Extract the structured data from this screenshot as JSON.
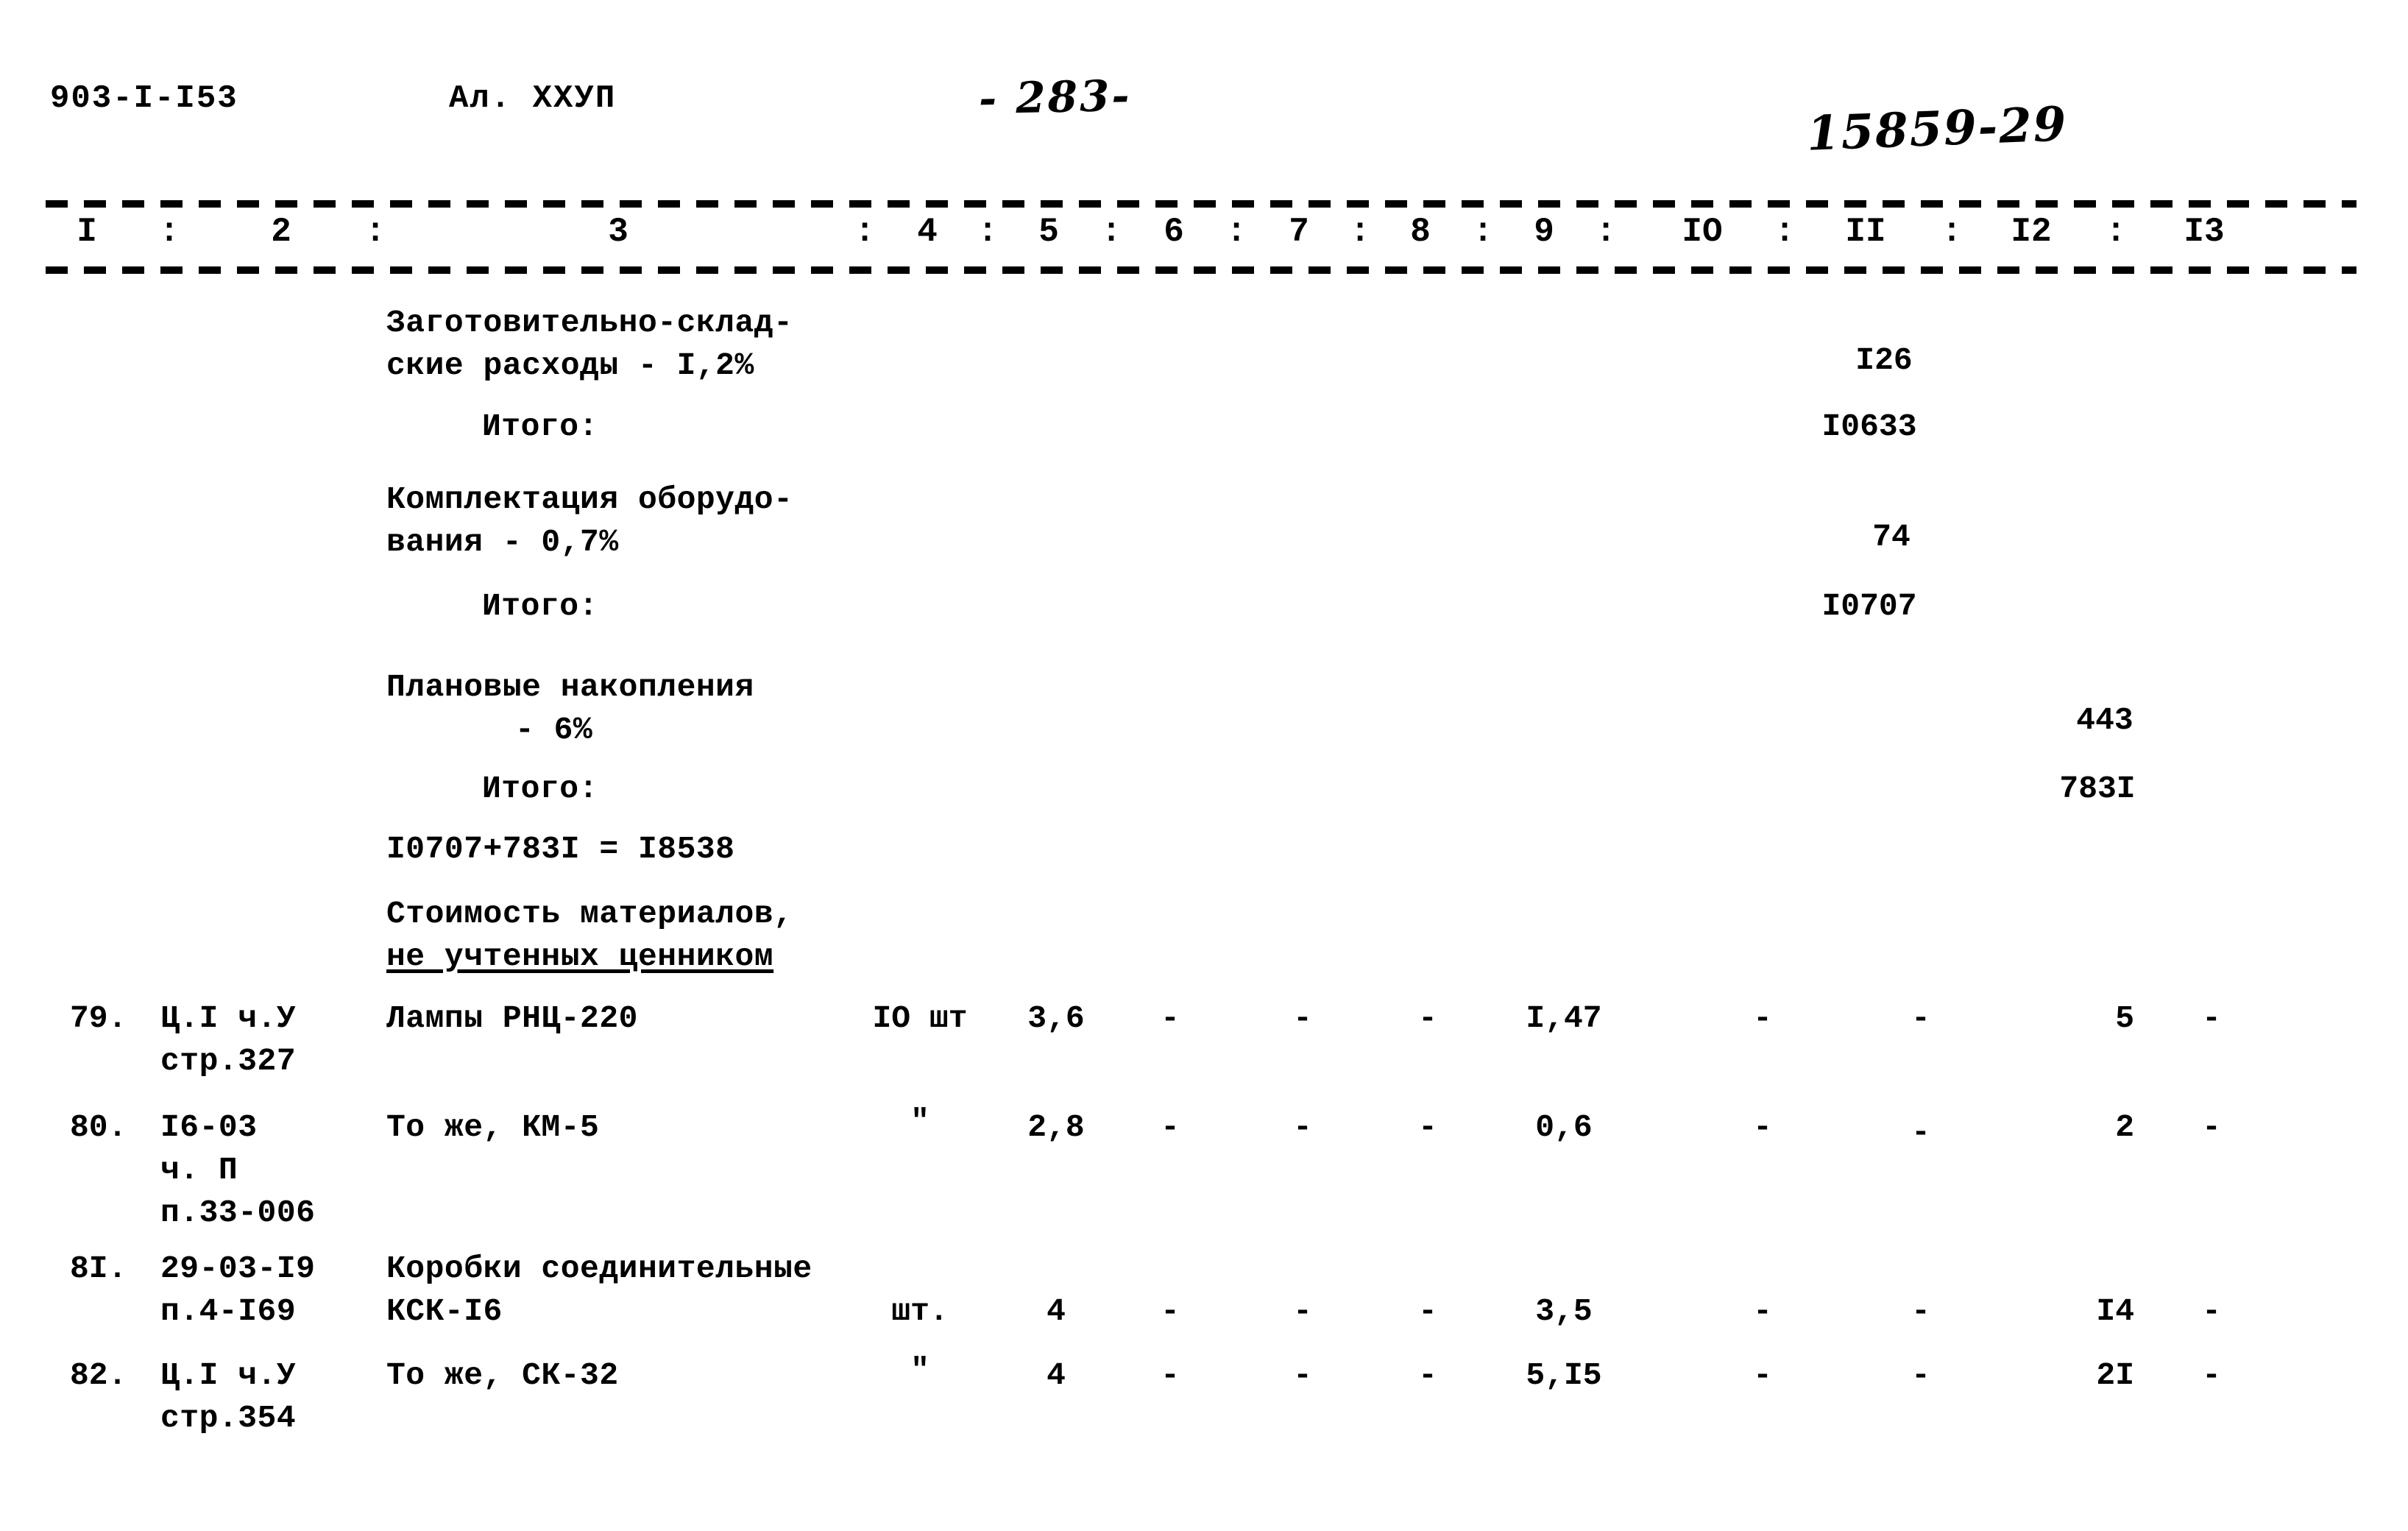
{
  "header": {
    "doc_code": "903-I-I53",
    "album": "Ал. ХХУП",
    "page_number": "- 283-",
    "archive_code": "15859-29"
  },
  "table": {
    "column_numbers": [
      "I",
      "2",
      "3",
      "4",
      "5",
      "6",
      "7",
      "8",
      "9",
      "IO",
      "II",
      "I2",
      "I3"
    ],
    "separator": ":"
  },
  "summary_rows": [
    {
      "name_line1": "Заготовительно-склад-",
      "name_line2": "ские расходы - I,2%",
      "col11": "I26"
    },
    {
      "name_line1": "Итого:",
      "col11": "I0633"
    },
    {
      "name_line1": "Комплектация оборудо-",
      "name_line2": "вания - 0,7%",
      "col11": "74"
    },
    {
      "name_line1": "Итого:",
      "col11": "I0707"
    },
    {
      "name_line1": "Плановые накопления",
      "name_line2": "- 6%",
      "col12": "443"
    },
    {
      "name_line1": "Итого:",
      "col12": "783I"
    },
    {
      "name_line1": "I0707+783I = I8538"
    }
  ],
  "section_heading": {
    "line1": "Стоимость материалов,",
    "line2": "не учтенных ценником"
  },
  "item_rows": [
    {
      "number": "79.",
      "code_line1": "Ц.I ч.У",
      "code_line2": "стр.327",
      "name": "Лампы РНЦ-220",
      "unit": "IO шт",
      "col4": "3,6",
      "col5": "-",
      "col6": "-",
      "col7": "-",
      "col8": "I,47",
      "col9": "-",
      "col10": "-",
      "col11": "5",
      "col12": "-"
    },
    {
      "number": "80.",
      "code_line1": "I6-03",
      "code_line2": "ч. П",
      "code_line3": "п.33-006",
      "name": "То же, КМ-5",
      "unit": "\"",
      "col4": "2,8",
      "col5": "-",
      "col6": "-",
      "col7": "-",
      "col8": "0,6",
      "col9": "-",
      "col10": "-",
      "col11": "2",
      "col12": "-"
    },
    {
      "number": "8I.",
      "code_line1": "29-03-I9",
      "code_line2": "п.4-I69",
      "name_line1": "Коробки соединительные",
      "name_line2": "КСК-I6",
      "unit": "шт.",
      "col4": "4",
      "col5": "-",
      "col6": "-",
      "col7": "-",
      "col8": "3,5",
      "col9": "-",
      "col10": "-",
      "col11": "I4",
      "col12": "-"
    },
    {
      "number": "82.",
      "code_line1": "Ц.I ч.У",
      "code_line2": "стр.354",
      "name": "То же, СК-32",
      "unit": "\"",
      "col4": "4",
      "col5": "-",
      "col6": "-",
      "col7": "-",
      "col8": "5,I5",
      "col9": "-",
      "col10": "-",
      "col11": "2I",
      "col12": "-"
    }
  ]
}
